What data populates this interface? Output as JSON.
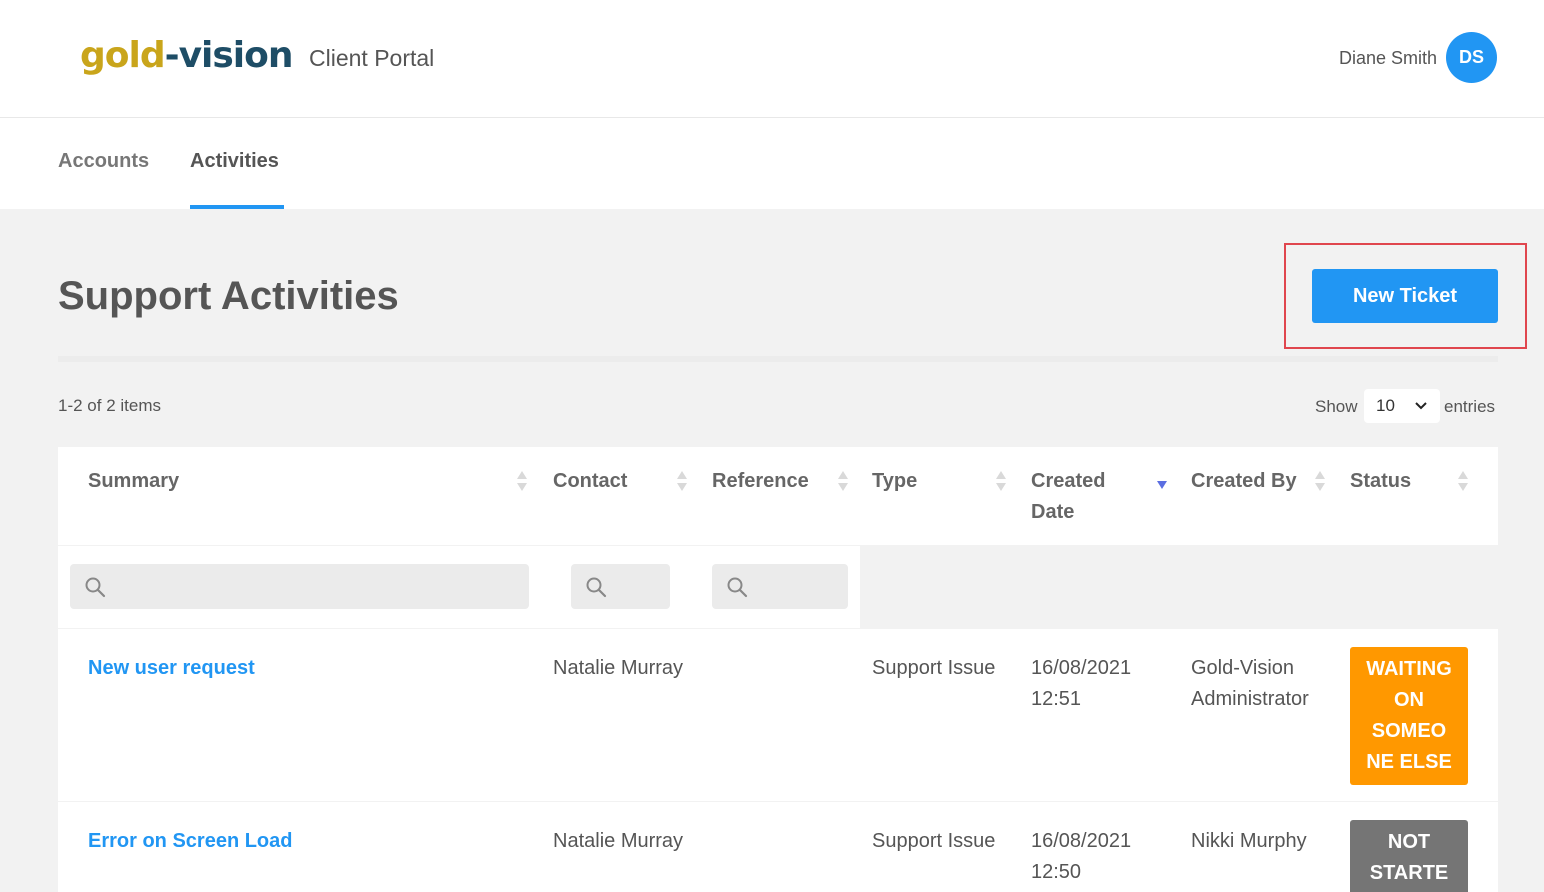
{
  "header": {
    "logo": {
      "part1": "gold",
      "part2": "-vision"
    },
    "portal_title": "Client Portal",
    "user_name": "Diane Smith",
    "avatar_initials": "DS"
  },
  "tabs": [
    {
      "label": "Accounts",
      "active": false
    },
    {
      "label": "Activities",
      "active": true
    }
  ],
  "page": {
    "title": "Support Activities",
    "new_ticket_label": "New Ticket"
  },
  "list": {
    "items_count": "1-2 of 2 items",
    "show_label": "Show",
    "entries_value": "10",
    "entries_label": "entries"
  },
  "table": {
    "columns": [
      {
        "label": "Summary",
        "sort": "none"
      },
      {
        "label": "Contact",
        "sort": "none"
      },
      {
        "label": "Reference",
        "sort": "none"
      },
      {
        "label": "Type",
        "sort": "none"
      },
      {
        "label": "Created Date",
        "sort": "descending"
      },
      {
        "label": "Created By",
        "sort": "none"
      },
      {
        "label": "Status",
        "sort": "none"
      }
    ],
    "filters": [
      {
        "column": "Summary",
        "placeholder": ""
      },
      {
        "column": "Contact",
        "placeholder": ""
      },
      {
        "column": "Reference",
        "placeholder": ""
      }
    ],
    "rows": [
      {
        "summary": "New user request",
        "contact": "Natalie Murray",
        "reference": "",
        "type": "Support Issue",
        "created_date": "16/08/2021",
        "created_time": "12:51",
        "created_by_line1": "Gold-Vision",
        "created_by_line2": "Administrator",
        "status_lines": [
          "WAITING",
          "ON",
          "SOMEO",
          "NE ELSE"
        ],
        "status_color": "#ff9800"
      },
      {
        "summary": "Error on Screen Load",
        "contact": "Natalie Murray",
        "reference": "",
        "type": "Support Issue",
        "created_date": "16/08/2021",
        "created_time": "12:50",
        "created_by_line1": "Nikki Murphy",
        "created_by_line2": "",
        "status_lines": [
          "NOT",
          "STARTE"
        ],
        "status_color": "#757575"
      }
    ]
  },
  "colors": {
    "accent": "#2196f3",
    "highlight": "#e0464e",
    "logo_gold": "#c9a51b",
    "logo_navy": "#1e4d66"
  },
  "icons": {
    "sort": "sort-arrows-icon",
    "sort_desc": "sort-desc-icon",
    "search": "search-icon",
    "dropdown": "chevron-down-icon"
  }
}
